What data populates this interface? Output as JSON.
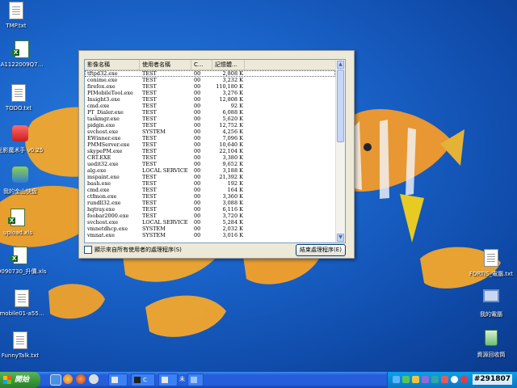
{
  "desktop": {
    "icons": [
      {
        "label": "TMP.txt",
        "type": "doc"
      },
      {
        "label": "A1122009Q7...",
        "type": "xls"
      },
      {
        "label": "TODO.txt",
        "type": "doc"
      },
      {
        "label": "光影魔术手 v0.25",
        "type": "app"
      },
      {
        "label": "我的金山快盘",
        "type": "app2"
      },
      {
        "label": "upload.xls",
        "type": "xls"
      },
      {
        "label": "20090730_升價.xls",
        "type": "xls"
      },
      {
        "label": "mobile01-a55...",
        "type": "doc"
      },
      {
        "label": "FunnyTalk.txt",
        "type": "doc"
      },
      {
        "label": "FORTIS_電腦.txt",
        "type": "doc"
      },
      {
        "label": "我的電腦",
        "type": "computer"
      },
      {
        "label": "資源回收筒",
        "type": "recycle"
      }
    ]
  },
  "taskmgr": {
    "columns": [
      "影像名稱",
      "使用者名稱",
      "C...",
      "記憶體..."
    ],
    "processes": [
      [
        "tftpd32.exe",
        "TEST",
        "00",
        "2,808 K"
      ],
      [
        "conime.exe",
        "TEST",
        "00",
        "3,232 K"
      ],
      [
        "firefox.exe",
        "TEST",
        "00",
        "110,180 K"
      ],
      [
        "PIMobileTool.exe",
        "TEST",
        "00",
        "3,276 K"
      ],
      [
        "Insight3.exe",
        "TEST",
        "00",
        "12,808 K"
      ],
      [
        "cmd.exe",
        "TEST",
        "00",
        "92 K"
      ],
      [
        "PT_Dialer.exe",
        "TEST",
        "00",
        "6,088 K"
      ],
      [
        "taskmgr.exe",
        "TEST",
        "00",
        "5,620 K"
      ],
      [
        "pidgin.exe",
        "TEST",
        "00",
        "12,752 K"
      ],
      [
        "svchost.exe",
        "SYSTEM",
        "00",
        "4,256 K"
      ],
      [
        "EWinner.exe",
        "TEST",
        "00",
        "7,096 K"
      ],
      [
        "PMMServer.exe",
        "TEST",
        "00",
        "10,640 K"
      ],
      [
        "skypePM.exe",
        "TEST",
        "00",
        "22,104 K"
      ],
      [
        "CRT.EXE",
        "TEST",
        "00",
        "3,380 K"
      ],
      [
        "uedit32.exe",
        "TEST",
        "00",
        "9,652 K"
      ],
      [
        "alg.exe",
        "LOCAL SERVICE",
        "00",
        "3,188 K"
      ],
      [
        "mspaint.exe",
        "TEST",
        "00",
        "21,392 K"
      ],
      [
        "bash.exe",
        "TEST",
        "00",
        "192 K"
      ],
      [
        "cmd.exe",
        "TEST",
        "00",
        "164 K"
      ],
      [
        "ctfmon.exe",
        "TEST",
        "00",
        "3,360 K"
      ],
      [
        "rundll32.exe",
        "TEST",
        "00",
        "3,088 K"
      ],
      [
        "hqtray.exe",
        "TEST",
        "00",
        "6,116 K"
      ],
      [
        "foobar2000.exe",
        "TEST",
        "00",
        "3,720 K"
      ],
      [
        "svchost.exe",
        "LOCAL SERVICE",
        "00",
        "5,284 K"
      ],
      [
        "vmnetdhcp.exe",
        "SYSTEM",
        "00",
        "2,032 K"
      ],
      [
        "vmnat.exe",
        "SYSTEM",
        "00",
        "3,016 K"
      ]
    ],
    "show_all_label": "顯示來自所有使用者的處理程序(S)",
    "end_process_label": "結束處理程序(E)"
  },
  "taskbar": {
    "start_label": "開始",
    "tasks": [
      {
        "label": "",
        "icon": "task-icon"
      },
      {
        "label": "C",
        "icon": "cmd-icon"
      },
      {
        "label": "",
        "icon": "task-icon"
      },
      {
        "label": "未",
        "icon": "app-icon"
      },
      {
        "label": "",
        "icon": "monitor-icon"
      }
    ],
    "clock": "#291807"
  }
}
